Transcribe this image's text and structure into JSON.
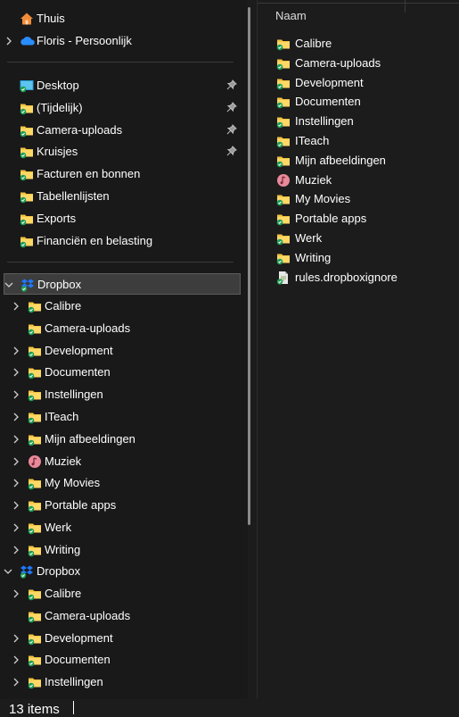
{
  "nav": {
    "quick": [
      {
        "label": "Thuis",
        "icon": "home-icon",
        "chevron": false
      },
      {
        "label": "Floris - Persoonlijk",
        "icon": "onedrive-cloud-icon",
        "chevron": true
      }
    ],
    "pinned": [
      {
        "label": "Desktop",
        "icon": "desktop-icon",
        "pinned": true
      },
      {
        "label": "(Tijdelijk)",
        "icon": "folder-icon",
        "pinned": true
      },
      {
        "label": "Camera-uploads",
        "icon": "folder-icon",
        "pinned": true
      },
      {
        "label": "Kruisjes",
        "icon": "folder-icon",
        "pinned": true
      },
      {
        "label": "Facturen en bonnen",
        "icon": "folder-icon",
        "pinned": false
      },
      {
        "label": "Tabellenlijsten",
        "icon": "folder-icon",
        "pinned": false
      },
      {
        "label": "Exports",
        "icon": "folder-icon",
        "pinned": false
      },
      {
        "label": "Financiën en belasting",
        "icon": "folder-icon",
        "pinned": false
      }
    ],
    "dropbox1": {
      "label": "Dropbox",
      "children": [
        {
          "label": "Calibre",
          "icon": "folder-icon",
          "chevron": true
        },
        {
          "label": "Camera-uploads",
          "icon": "folder-icon",
          "chevron": false
        },
        {
          "label": "Development",
          "icon": "folder-icon",
          "chevron": true
        },
        {
          "label": "Documenten",
          "icon": "folder-icon",
          "chevron": true
        },
        {
          "label": "Instellingen",
          "icon": "folder-icon",
          "chevron": true
        },
        {
          "label": "ITeach",
          "icon": "folder-icon",
          "chevron": true
        },
        {
          "label": "Mijn afbeeldingen",
          "icon": "folder-icon",
          "chevron": true
        },
        {
          "label": "Muziek",
          "icon": "music-folder-icon",
          "chevron": true
        },
        {
          "label": "My Movies",
          "icon": "folder-icon",
          "chevron": true
        },
        {
          "label": "Portable apps",
          "icon": "folder-icon",
          "chevron": true
        },
        {
          "label": "Werk",
          "icon": "folder-icon",
          "chevron": true
        },
        {
          "label": "Writing",
          "icon": "folder-icon",
          "chevron": true
        }
      ]
    },
    "dropbox2": {
      "label": "Dropbox",
      "children": [
        {
          "label": "Calibre",
          "icon": "folder-icon",
          "chevron": true
        },
        {
          "label": "Camera-uploads",
          "icon": "folder-icon",
          "chevron": false
        },
        {
          "label": "Development",
          "icon": "folder-icon",
          "chevron": true
        },
        {
          "label": "Documenten",
          "icon": "folder-icon",
          "chevron": true
        },
        {
          "label": "Instellingen",
          "icon": "folder-icon",
          "chevron": true
        }
      ]
    }
  },
  "content": {
    "column_header": "Naam",
    "items": [
      {
        "label": "Calibre",
        "icon": "folder-icon"
      },
      {
        "label": "Camera-uploads",
        "icon": "folder-icon"
      },
      {
        "label": "Development",
        "icon": "folder-icon"
      },
      {
        "label": "Documenten",
        "icon": "folder-icon"
      },
      {
        "label": "Instellingen",
        "icon": "folder-icon"
      },
      {
        "label": "ITeach",
        "icon": "folder-icon"
      },
      {
        "label": "Mijn afbeeldingen",
        "icon": "folder-icon"
      },
      {
        "label": "Muziek",
        "icon": "music-folder-icon"
      },
      {
        "label": "My Movies",
        "icon": "folder-icon"
      },
      {
        "label": "Portable apps",
        "icon": "folder-icon"
      },
      {
        "label": "Werk",
        "icon": "folder-icon"
      },
      {
        "label": "Writing",
        "icon": "folder-icon"
      },
      {
        "label": "rules.dropboxignore",
        "icon": "file-icon"
      }
    ]
  },
  "status": {
    "items_count": "13 items"
  },
  "colors": {
    "folder": "#f4c542",
    "sync_check": "#1f9d55",
    "dropbox_blue": "#1e78ff",
    "onedrive_blue": "#2a8dff"
  }
}
